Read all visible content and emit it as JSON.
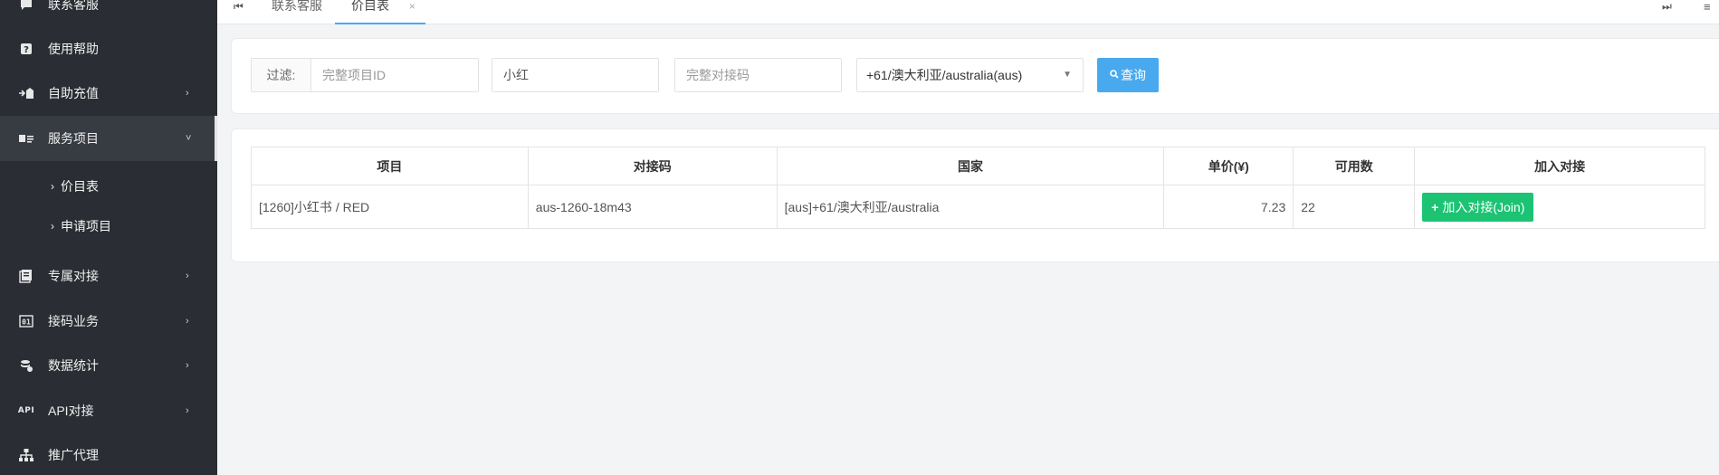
{
  "sidebar": {
    "items": [
      {
        "label": "联系客服",
        "icon": "chat-icon",
        "has_chevron": false
      },
      {
        "label": "使用帮助",
        "icon": "help-icon",
        "has_chevron": false
      },
      {
        "label": "自助充值",
        "icon": "recharge-icon",
        "has_chevron": true
      },
      {
        "label": "服务项目",
        "icon": "service-icon",
        "has_chevron": true,
        "expanded": true
      },
      {
        "label": "专属对接",
        "icon": "exclusive-icon",
        "has_chevron": true
      },
      {
        "label": "接码业务",
        "icon": "code-icon",
        "has_chevron": true
      },
      {
        "label": "数据统计",
        "icon": "stats-icon",
        "has_chevron": true
      },
      {
        "label": "API对接",
        "icon": "api-icon",
        "has_chevron": true
      },
      {
        "label": "推广代理",
        "icon": "sitemap-icon",
        "has_chevron": false
      }
    ],
    "subitems": [
      {
        "label": "价目表"
      },
      {
        "label": "申请项目"
      }
    ],
    "api_badge": "API"
  },
  "tabs": {
    "items": [
      {
        "label": "联系客服"
      },
      {
        "label": "价目表",
        "active": true,
        "close": "×"
      }
    ]
  },
  "filter": {
    "label": "过滤:",
    "project_id_placeholder": "完整项目ID",
    "keyword_value": "小红",
    "code_placeholder": "完整对接码",
    "country_selected": "+61/澳大利亚/australia(aus)",
    "query_label": "查询"
  },
  "table": {
    "headers": [
      "项目",
      "对接码",
      "国家",
      "单价(¥)",
      "可用数",
      "加入对接"
    ],
    "rows": [
      {
        "project": "[1260]小红书 / RED",
        "code": "aus-1260-18m43",
        "country": "[aus]+61/澳大利亚/australia",
        "price": "7.23",
        "available": "22",
        "join_label": "加入对接(Join)"
      }
    ]
  },
  "colors": {
    "sidebar_bg": "#2a2d33",
    "query_button": "#49a9ee",
    "join_button": "#1cc373",
    "price_text": "#2e8b2e",
    "active_tab_underline": "#4aa7f5"
  }
}
